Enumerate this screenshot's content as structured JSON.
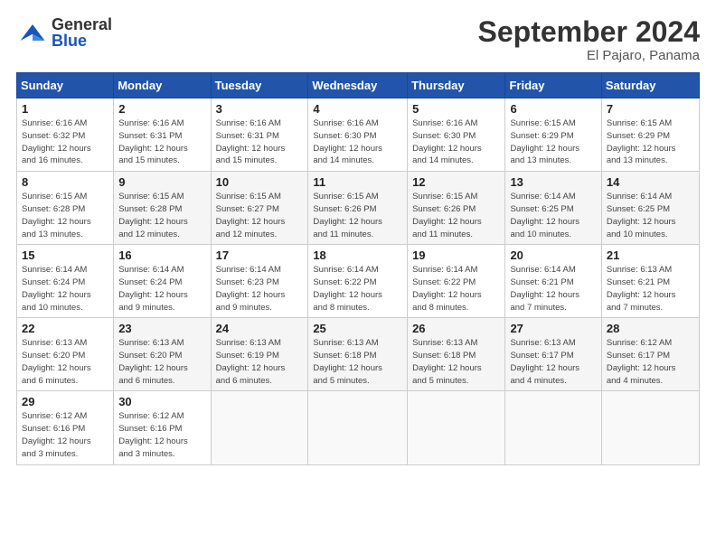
{
  "header": {
    "logo_general": "General",
    "logo_blue": "Blue",
    "month_title": "September 2024",
    "location": "El Pajaro, Panama"
  },
  "columns": [
    "Sunday",
    "Monday",
    "Tuesday",
    "Wednesday",
    "Thursday",
    "Friday",
    "Saturday"
  ],
  "weeks": [
    [
      {
        "day": "1",
        "info": "Sunrise: 6:16 AM\nSunset: 6:32 PM\nDaylight: 12 hours\nand 16 minutes."
      },
      {
        "day": "2",
        "info": "Sunrise: 6:16 AM\nSunset: 6:31 PM\nDaylight: 12 hours\nand 15 minutes."
      },
      {
        "day": "3",
        "info": "Sunrise: 6:16 AM\nSunset: 6:31 PM\nDaylight: 12 hours\nand 15 minutes."
      },
      {
        "day": "4",
        "info": "Sunrise: 6:16 AM\nSunset: 6:30 PM\nDaylight: 12 hours\nand 14 minutes."
      },
      {
        "day": "5",
        "info": "Sunrise: 6:16 AM\nSunset: 6:30 PM\nDaylight: 12 hours\nand 14 minutes."
      },
      {
        "day": "6",
        "info": "Sunrise: 6:15 AM\nSunset: 6:29 PM\nDaylight: 12 hours\nand 13 minutes."
      },
      {
        "day": "7",
        "info": "Sunrise: 6:15 AM\nSunset: 6:29 PM\nDaylight: 12 hours\nand 13 minutes."
      }
    ],
    [
      {
        "day": "8",
        "info": "Sunrise: 6:15 AM\nSunset: 6:28 PM\nDaylight: 12 hours\nand 13 minutes."
      },
      {
        "day": "9",
        "info": "Sunrise: 6:15 AM\nSunset: 6:28 PM\nDaylight: 12 hours\nand 12 minutes."
      },
      {
        "day": "10",
        "info": "Sunrise: 6:15 AM\nSunset: 6:27 PM\nDaylight: 12 hours\nand 12 minutes."
      },
      {
        "day": "11",
        "info": "Sunrise: 6:15 AM\nSunset: 6:26 PM\nDaylight: 12 hours\nand 11 minutes."
      },
      {
        "day": "12",
        "info": "Sunrise: 6:15 AM\nSunset: 6:26 PM\nDaylight: 12 hours\nand 11 minutes."
      },
      {
        "day": "13",
        "info": "Sunrise: 6:14 AM\nSunset: 6:25 PM\nDaylight: 12 hours\nand 10 minutes."
      },
      {
        "day": "14",
        "info": "Sunrise: 6:14 AM\nSunset: 6:25 PM\nDaylight: 12 hours\nand 10 minutes."
      }
    ],
    [
      {
        "day": "15",
        "info": "Sunrise: 6:14 AM\nSunset: 6:24 PM\nDaylight: 12 hours\nand 10 minutes."
      },
      {
        "day": "16",
        "info": "Sunrise: 6:14 AM\nSunset: 6:24 PM\nDaylight: 12 hours\nand 9 minutes."
      },
      {
        "day": "17",
        "info": "Sunrise: 6:14 AM\nSunset: 6:23 PM\nDaylight: 12 hours\nand 9 minutes."
      },
      {
        "day": "18",
        "info": "Sunrise: 6:14 AM\nSunset: 6:22 PM\nDaylight: 12 hours\nand 8 minutes."
      },
      {
        "day": "19",
        "info": "Sunrise: 6:14 AM\nSunset: 6:22 PM\nDaylight: 12 hours\nand 8 minutes."
      },
      {
        "day": "20",
        "info": "Sunrise: 6:14 AM\nSunset: 6:21 PM\nDaylight: 12 hours\nand 7 minutes."
      },
      {
        "day": "21",
        "info": "Sunrise: 6:13 AM\nSunset: 6:21 PM\nDaylight: 12 hours\nand 7 minutes."
      }
    ],
    [
      {
        "day": "22",
        "info": "Sunrise: 6:13 AM\nSunset: 6:20 PM\nDaylight: 12 hours\nand 6 minutes."
      },
      {
        "day": "23",
        "info": "Sunrise: 6:13 AM\nSunset: 6:20 PM\nDaylight: 12 hours\nand 6 minutes."
      },
      {
        "day": "24",
        "info": "Sunrise: 6:13 AM\nSunset: 6:19 PM\nDaylight: 12 hours\nand 6 minutes."
      },
      {
        "day": "25",
        "info": "Sunrise: 6:13 AM\nSunset: 6:18 PM\nDaylight: 12 hours\nand 5 minutes."
      },
      {
        "day": "26",
        "info": "Sunrise: 6:13 AM\nSunset: 6:18 PM\nDaylight: 12 hours\nand 5 minutes."
      },
      {
        "day": "27",
        "info": "Sunrise: 6:13 AM\nSunset: 6:17 PM\nDaylight: 12 hours\nand 4 minutes."
      },
      {
        "day": "28",
        "info": "Sunrise: 6:12 AM\nSunset: 6:17 PM\nDaylight: 12 hours\nand 4 minutes."
      }
    ],
    [
      {
        "day": "29",
        "info": "Sunrise: 6:12 AM\nSunset: 6:16 PM\nDaylight: 12 hours\nand 3 minutes."
      },
      {
        "day": "30",
        "info": "Sunrise: 6:12 AM\nSunset: 6:16 PM\nDaylight: 12 hours\nand 3 minutes."
      },
      {
        "day": "",
        "info": ""
      },
      {
        "day": "",
        "info": ""
      },
      {
        "day": "",
        "info": ""
      },
      {
        "day": "",
        "info": ""
      },
      {
        "day": "",
        "info": ""
      }
    ]
  ]
}
